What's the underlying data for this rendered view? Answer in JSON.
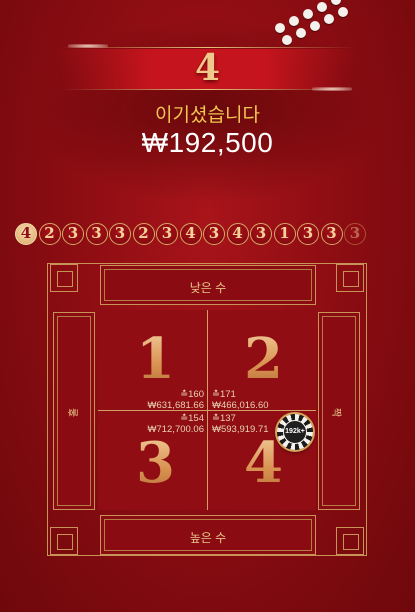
{
  "result": {
    "number": "4",
    "win_label": "이기셨습니다",
    "win_amount": "₩192,500"
  },
  "history": [
    "4",
    "2",
    "3",
    "3",
    "3",
    "2",
    "3",
    "4",
    "3",
    "4",
    "3",
    "1",
    "3",
    "3",
    "3"
  ],
  "board": {
    "low_label": "낮은 수",
    "high_label": "높은 수",
    "odd_label": "홀",
    "even_label": "짝",
    "cells": [
      {
        "numeral": "1",
        "count": "≛160",
        "amount": "₩631,681.66"
      },
      {
        "numeral": "2",
        "count": "≛171",
        "amount": "₩466,016.60"
      },
      {
        "numeral": "3",
        "count": "≛154",
        "amount": "₩712,700.06"
      },
      {
        "numeral": "4",
        "count": "≛137",
        "amount": "₩593,919.71"
      }
    ]
  },
  "chip": {
    "label": "192k+"
  },
  "colors": {
    "accent_gold": "#e8c58a",
    "table_red": "#8f0d13",
    "win_text": "#f2c552"
  }
}
